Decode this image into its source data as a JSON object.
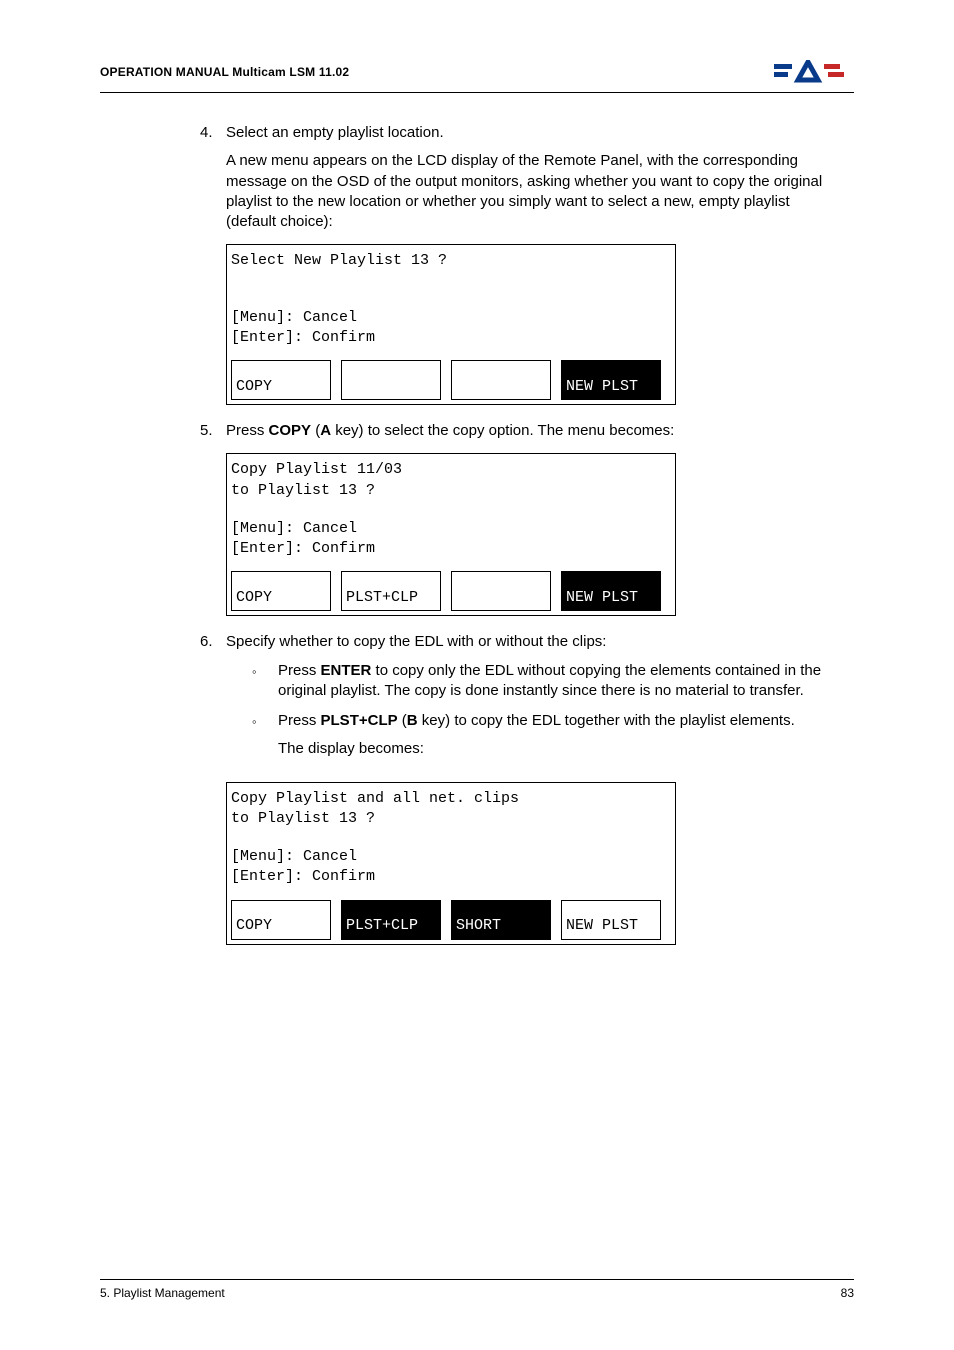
{
  "header": {
    "title": "OPERATION MANUAL Multicam LSM 11.02"
  },
  "step4": {
    "num": "4.",
    "title": "Select an empty playlist location.",
    "body": "A new menu appears on the LCD display of the Remote Panel, with the corresponding message on the OSD of the output monitors, asking whether you want to copy the original playlist to the new location or whether you simply want to select a new, empty playlist (default choice):"
  },
  "lcd1": {
    "l1": "Select New Playlist 13 ?",
    "l2": "",
    "l3": "",
    "l4": "[Menu]: Cancel",
    "l5": "[Enter]: Confirm",
    "b1": "COPY",
    "b2": "",
    "b3": "",
    "b4": "NEW PLST"
  },
  "step5": {
    "num": "5.",
    "text_pre": "Press ",
    "key": "COPY",
    "text_mid": " (",
    "key2": "A",
    "text_post": " key) to select the copy option. The menu becomes:"
  },
  "lcd2": {
    "l1": "Copy Playlist 11/03",
    "l2": "to Playlist 13 ?",
    "l3": "",
    "l4": "[Menu]: Cancel",
    "l5": "[Enter]: Confirm",
    "b1": "COPY",
    "b2": "PLST+CLP",
    "b3": "",
    "b4": "NEW PLST"
  },
  "step6": {
    "num": "6.",
    "title": "Specify whether to copy the EDL with or without the clips:",
    "sub1_pre": "Press ",
    "sub1_key": "ENTER",
    "sub1_post": " to copy only the EDL without copying the elements contained in the original playlist. The copy is done instantly since there is no material to transfer.",
    "sub2_pre": "Press ",
    "sub2_key": "PLST+CLP",
    "sub2_mid": " (",
    "sub2_key2": "B",
    "sub2_post": " key) to copy the EDL together with the playlist elements.",
    "sub2_tail": "The display becomes:"
  },
  "lcd3": {
    "l1": "Copy Playlist and all net. clips",
    "l2": "to Playlist 13 ?",
    "l3": "",
    "l4": "[Menu]: Cancel",
    "l5": "[Enter]: Confirm",
    "b1": "COPY",
    "b2": "PLST+CLP",
    "b3": "SHORT",
    "b4": "NEW PLST"
  },
  "footer": {
    "left": "5. Playlist Management",
    "right": "83"
  }
}
